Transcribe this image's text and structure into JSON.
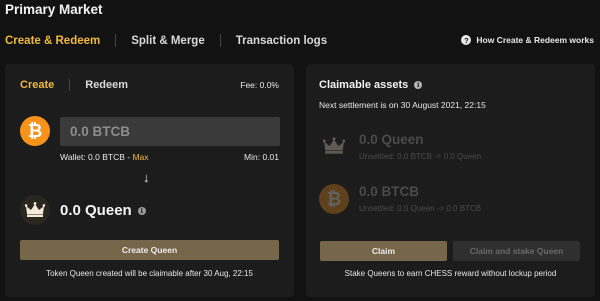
{
  "page_title": "Primary Market",
  "tabs": [
    {
      "label": "Create & Redeem",
      "active": true
    },
    {
      "label": "Split & Merge",
      "active": false
    },
    {
      "label": "Transaction logs",
      "active": false
    }
  ],
  "help_link": "How Create & Redeem works",
  "create_card": {
    "tabs": [
      "Create",
      "Redeem"
    ],
    "fee": "Fee: 0.0%",
    "input": {
      "placeholder": "0.0 BTCB",
      "value": ""
    },
    "wallet_prefix": "Wallet: 0.0 BTCB - ",
    "max_label": "Max",
    "min_label": "Min: 0.01",
    "arrow": "↓",
    "output_amount": "0.0 Queen",
    "create_button": "Create Queen",
    "note": "Token Queen created will be claimable after 30 Aug, 22:15"
  },
  "claim_card": {
    "title": "Claimable assets",
    "settlement": "Next settlement is on 30 August 2021, 22:15",
    "assets": [
      {
        "amount": "0.0 Queen",
        "sub": "Unsettled: 0.0 BTCB -> 0.0 Queen",
        "icon": "queen-crown-icon"
      },
      {
        "amount": "0.0 BTCB",
        "sub": "Unsettled: 0.0 Queen -> 0.0 BTCB",
        "icon": "btc-icon"
      }
    ],
    "claim_button": "Claim",
    "claim_stake_button": "Claim and stake Queen",
    "stake_note": "Stake Queens to earn CHESS reward without lockup period"
  },
  "colors": {
    "accent": "#f0b93a",
    "bitcoin": "#f7931a",
    "button": "#76674b",
    "card": "#1c1c1c",
    "background": "#121212"
  }
}
